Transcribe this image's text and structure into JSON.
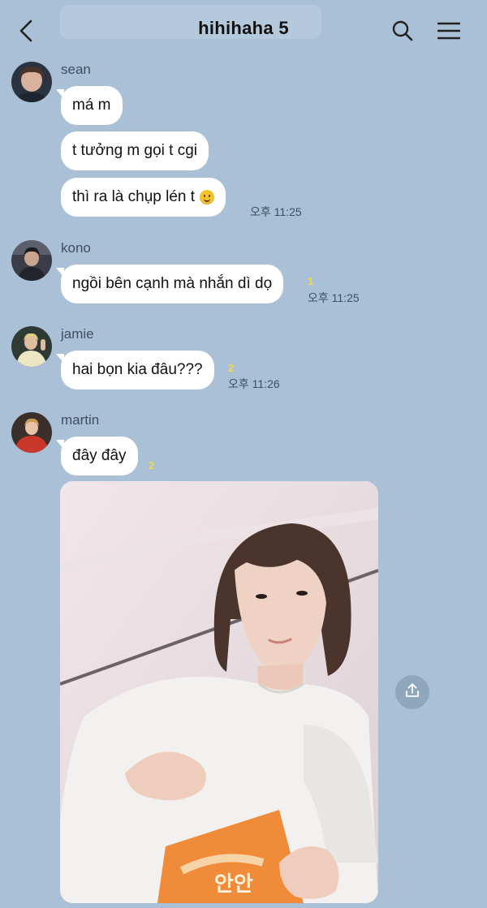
{
  "header": {
    "title": "hihihaha 5",
    "back_icon": "chevron-left-icon",
    "search_icon": "search-icon",
    "menu_icon": "hamburger-menu-icon"
  },
  "colors": {
    "background": "#a9c0d6",
    "bubble": "#ffffff",
    "unread": "#f2d84b",
    "meta_text": "#3f4f61"
  },
  "messages": [
    {
      "sender": "sean",
      "bubbles": [
        "má m",
        "t tưởng m gọi t cgi",
        "thì ra là chụp lén t"
      ],
      "emoji": "slightly-smiling-face-icon",
      "unread": "",
      "time": "오후 11:25"
    },
    {
      "sender": "kono",
      "bubbles": [
        "ngồi bên cạnh mà nhắn dì dọ"
      ],
      "unread": "1",
      "time": "오후 11:25"
    },
    {
      "sender": "jamie",
      "bubbles": [
        "hai bọn kia đâu???"
      ],
      "unread": "2",
      "time": "오후 11:26"
    },
    {
      "sender": "martin",
      "bubbles": [
        "đây đây"
      ],
      "unread": "2",
      "photo": "shared-photo",
      "share_icon": "share-upload-icon"
    }
  ]
}
